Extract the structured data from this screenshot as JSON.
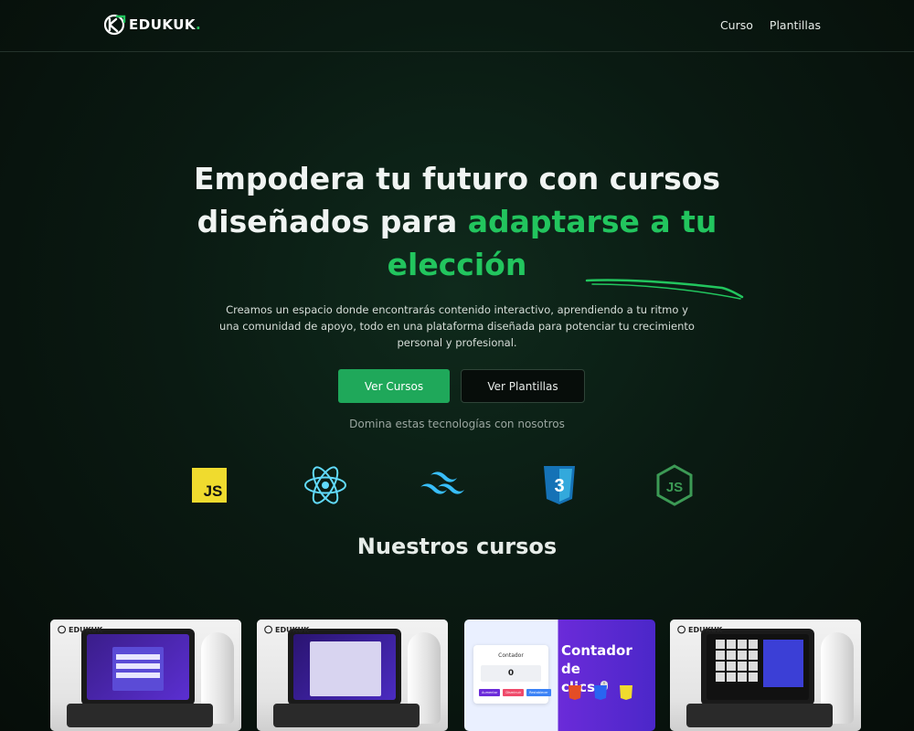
{
  "nav": {
    "logo_text": "EDUKUK",
    "logo_dot": ".",
    "links": [
      "Curso",
      "Plantillas"
    ]
  },
  "hero": {
    "title_line1": "Empodera tu futuro con cursos",
    "title_line2_plain": "diseñados para ",
    "title_line2_accent": "adaptarse a tu",
    "title_line3_accent": "elección",
    "description": "Creamos un espacio donde encontrarás contenido interactivo, aprendiendo a tu ritmo y una comunidad de apoyo, todo en una plataforma diseñada para potenciar tu crecimiento personal y profesional.",
    "primary_button": "Ver Cursos",
    "secondary_button": "Ver Plantillas",
    "tech_caption": "Domina estas tecnologías con nosotros"
  },
  "technologies": [
    {
      "name": "javascript-icon",
      "label": "JS"
    },
    {
      "name": "react-icon"
    },
    {
      "name": "tailwind-icon"
    },
    {
      "name": "css3-icon",
      "label": "3"
    },
    {
      "name": "nodejs-icon",
      "label": "JS"
    }
  ],
  "courses": {
    "section_title": "Nuestros cursos",
    "cards": [
      {
        "brand": "EDUKUK"
      },
      {
        "brand": "EDUKUK"
      },
      {
        "counter_label": "Contador",
        "counter_value": "0",
        "title_line1": "Contador de",
        "title_line2": "clics",
        "buttons": [
          "Aumentar",
          "Disminuir",
          "Restablecer"
        ]
      },
      {
        "brand": "EDUKUK"
      }
    ]
  },
  "colors": {
    "accent": "#22c55e",
    "button_primary": "#1fa85a",
    "background": "#0a1a12"
  }
}
